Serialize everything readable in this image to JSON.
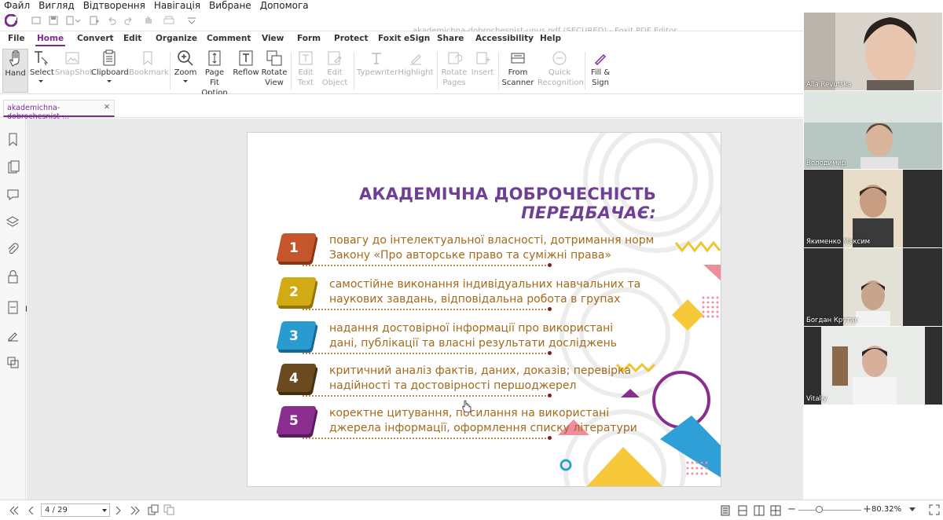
{
  "os_menu": [
    "Файл",
    "Вигляд",
    "Відтворення",
    "Навігація",
    "Вибране",
    "Допомога"
  ],
  "window_title": "akademichna-dobrochesnist-unus.pdf (SECURED) - Foxit PDF Editor",
  "ribbon_tabs": [
    "File",
    "Home",
    "Convert",
    "Edit",
    "Organize",
    "Comment",
    "View",
    "Form",
    "Protect",
    "Foxit eSign",
    "Share",
    "Accessibility",
    "Help"
  ],
  "tools": {
    "hand": "Hand",
    "select": "Select",
    "snapshot": "SnapShot",
    "clipboard": "Clipboard",
    "bookmark": "Bookmark",
    "zoom": "Zoom",
    "pagefit1": "Page Fit",
    "pagefit2": "Option",
    "reflow": "Reflow",
    "rotate1": "Rotate",
    "rotate2": "View",
    "edittext1": "Edit",
    "edittext2": "Text",
    "editobj1": "Edit",
    "editobj2": "Object",
    "typewriter": "Typewriter",
    "highlight": "Highlight",
    "rotpages1": "Rotate",
    "rotpages2": "Pages",
    "insert": "Insert",
    "scanner1": "From",
    "scanner2": "Scanner",
    "quick1": "Quick",
    "quick2": "Recognition",
    "fill1": "Fill &",
    "fill2": "Sign"
  },
  "doc_tab": "akademichna-dobrochesnist-...",
  "slide": {
    "title_a": "АКАДЕМІЧНА ДОБРОЧЕСНІСТЬ ",
    "title_b": "ПЕРЕДБАЧАЄ:",
    "items": [
      {
        "num": "1",
        "l1": "повагу до інтелектуальної власності, дотримання норм",
        "l2": "Закону «Про авторське право та суміжні права»",
        "color": "#c5562c"
      },
      {
        "num": "2",
        "l1": "самостійне виконання індивідуальних навчальних та",
        "l2": "наукових завдань, відповідальна робота в групах",
        "color": "#d2aa13"
      },
      {
        "num": "3",
        "l1": "надання достовірної інформації про використані",
        "l2": "дані, публікації та власні результати досліджень",
        "color": "#2a9bd0"
      },
      {
        "num": "4",
        "l1": "критичний аналіз фактів, даних, доказів; перевірка",
        "l2": "надійності та достовірності першоджерел",
        "color": "#6a4a1e"
      },
      {
        "num": "5",
        "l1": "коректне цитування, посилання на використані",
        "l2": "джерела інформації, оформлення списку літератури",
        "color": "#8a2d8f"
      }
    ]
  },
  "status": {
    "page": "4 / 29",
    "zoom": "80.32%"
  },
  "participants": [
    {
      "name": "Alla Revutska"
    },
    {
      "name": "Володимир"
    },
    {
      "name": "Якименко Максим"
    },
    {
      "name": "Богдан Крутас"
    },
    {
      "name": "Vitaliy"
    }
  ],
  "colors": {
    "accent": "#7b2b8f"
  }
}
